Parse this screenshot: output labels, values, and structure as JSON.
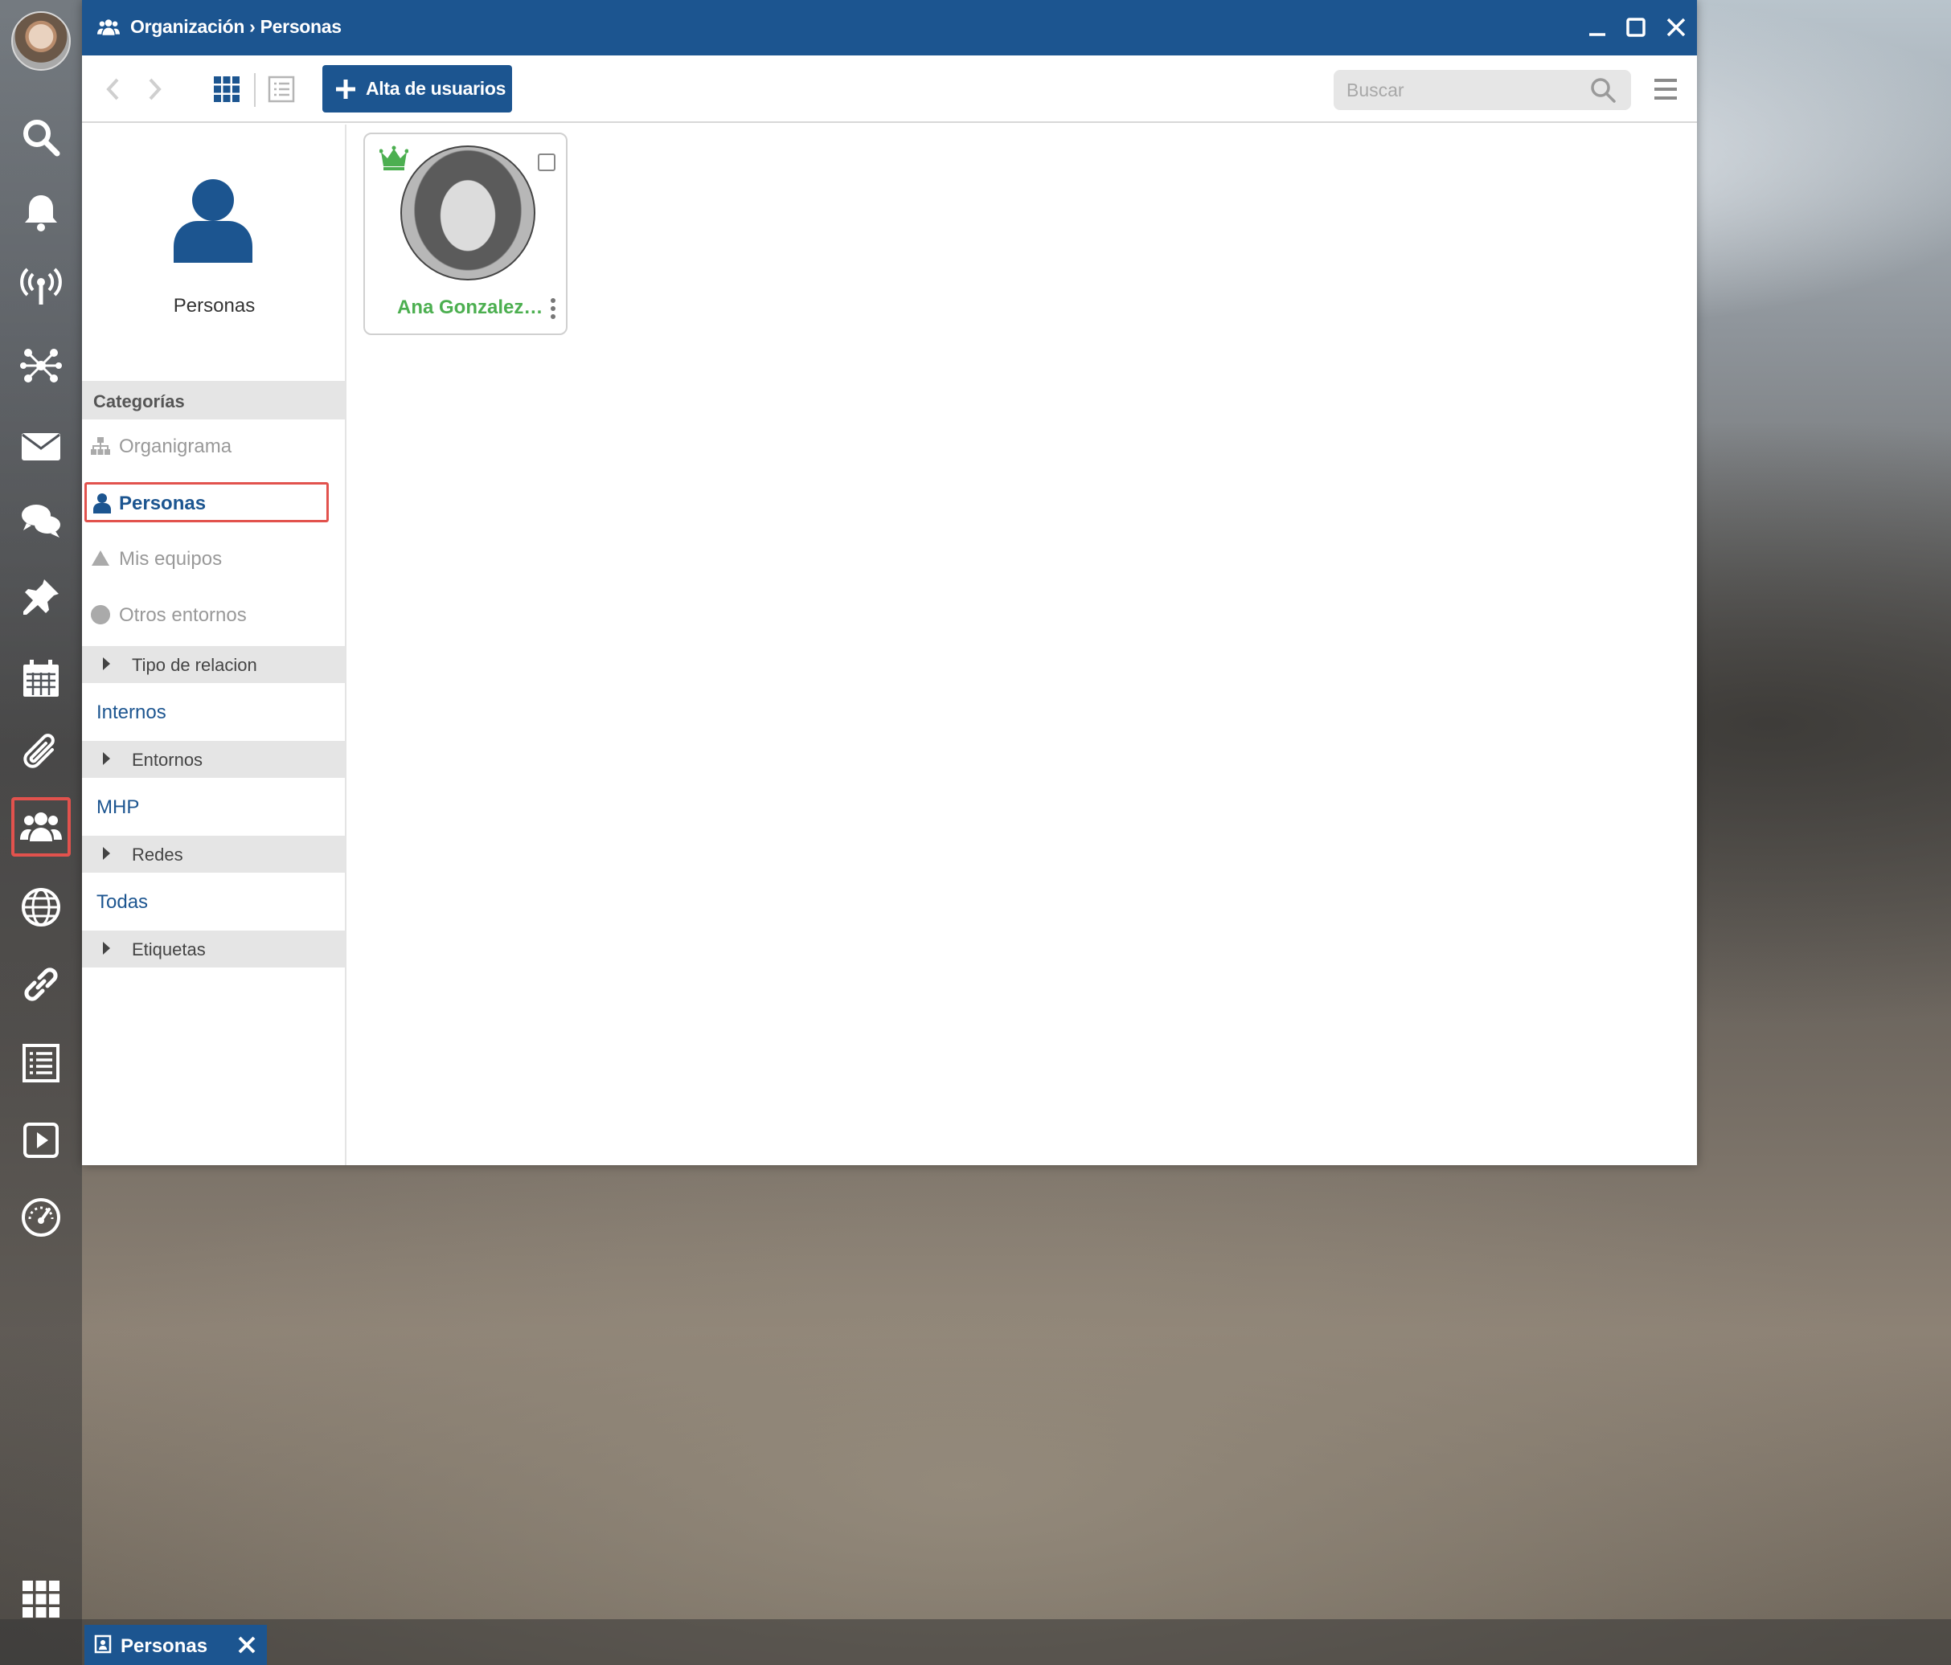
{
  "window": {
    "title": "Organización › Personas",
    "minimize_icon": "minimize-icon",
    "maximize_icon": "maximize-icon",
    "close_icon": "close-icon"
  },
  "toolbar": {
    "add_users_label": "Alta de usuarios",
    "search_placeholder": "Buscar"
  },
  "sidebar": {
    "header_label": "Personas",
    "categories_title": "Categorías",
    "items": [
      {
        "label": "Organigrama",
        "icon": "org-chart-icon"
      },
      {
        "label": "Personas",
        "icon": "person-icon",
        "selected": true
      },
      {
        "label": "Mis equipos",
        "icon": "triangle-icon"
      },
      {
        "label": "Otros entornos",
        "icon": "globe-icon"
      }
    ],
    "groups": [
      {
        "bar": "Tipo de relacion",
        "link": "Internos"
      },
      {
        "bar": "Entornos",
        "link": "MHP"
      },
      {
        "bar": "Redes",
        "link": "Todas"
      },
      {
        "bar": "Etiquetas",
        "link": ""
      }
    ]
  },
  "cards": [
    {
      "name": "Ana Gonzalez Pérez",
      "badge": "crown-icon"
    }
  ],
  "dock": [
    "search-icon",
    "bell-icon",
    "broadcast-icon",
    "network-icon",
    "mail-icon",
    "chat-icon",
    "pin-icon",
    "calendar-icon",
    "paperclip-icon",
    "users-icon",
    "globe-icon",
    "link-icon",
    "list-icon",
    "play-icon",
    "gauge-icon"
  ],
  "taskbar": {
    "tab_label": "Personas"
  },
  "colors": {
    "primary": "#1c5590",
    "accent_red": "#e2524d",
    "name_green": "#4caf50"
  }
}
